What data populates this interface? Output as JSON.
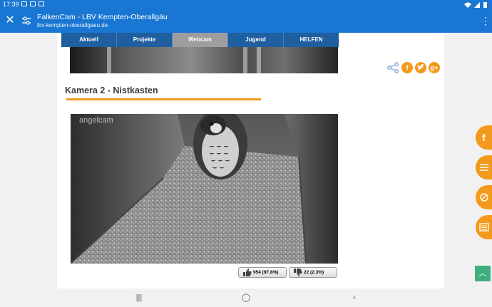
{
  "status": {
    "time": "17:39"
  },
  "browser": {
    "title": "FalkenCam - LBV Kempten-Oberallgäu",
    "url": "lbv-kempten-oberallgaeu.de"
  },
  "nav": {
    "tabs": [
      "Aktuell",
      "Projekte",
      "Webcam",
      "Jugend",
      "HELFEN"
    ],
    "active": "Webcam"
  },
  "section": {
    "title": "Kamera 2 - Nistkasten"
  },
  "camera": {
    "watermark": "angelcam"
  },
  "votes": {
    "up": "954 (97.8%)",
    "down": "22 (2.3%)"
  },
  "share": {
    "facebook": "f",
    "googleplus": "g+"
  },
  "colors": {
    "brand": "#1976d2",
    "nav": "#1f5fa0",
    "accent": "#f39a1c",
    "scrollup": "#3fae7e"
  }
}
